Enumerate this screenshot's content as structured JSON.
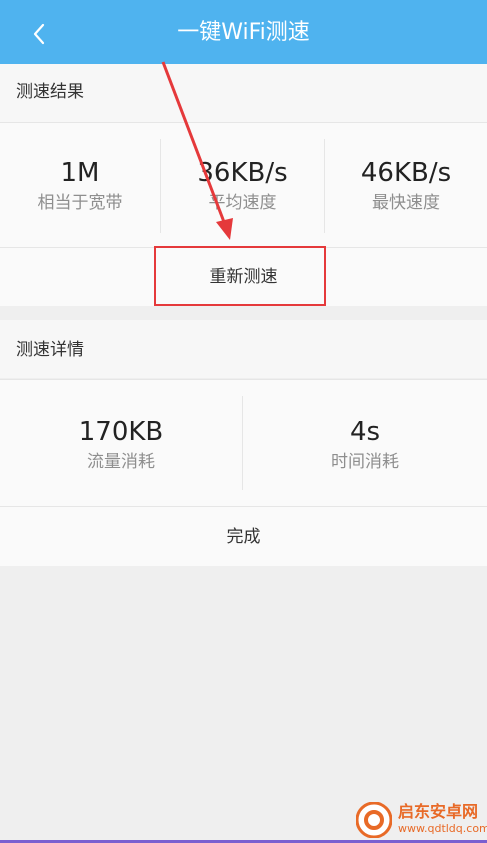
{
  "header": {
    "title": "一键WiFi测速",
    "back_icon": "chevron-left-icon"
  },
  "result_section": {
    "label": "测速结果",
    "stats": [
      {
        "value": "1M",
        "label": "相当于宽带"
      },
      {
        "value": "36KB/s",
        "label": "平均速度"
      },
      {
        "value": "46KB/s",
        "label": "最快速度"
      }
    ],
    "retest_label": "重新测速"
  },
  "detail_section": {
    "label": "测速详情",
    "stats": [
      {
        "value": "170KB",
        "label": "流量消耗"
      },
      {
        "value": "4s",
        "label": "时间消耗"
      }
    ],
    "done_label": "完成"
  },
  "annotation": {
    "highlight_color": "#e5393b"
  },
  "watermark": {
    "name": "启东安卓网",
    "url": "www.qdtldq.com"
  },
  "colors": {
    "header_bg": "#4fb3ef",
    "page_bg": "#efefef"
  }
}
